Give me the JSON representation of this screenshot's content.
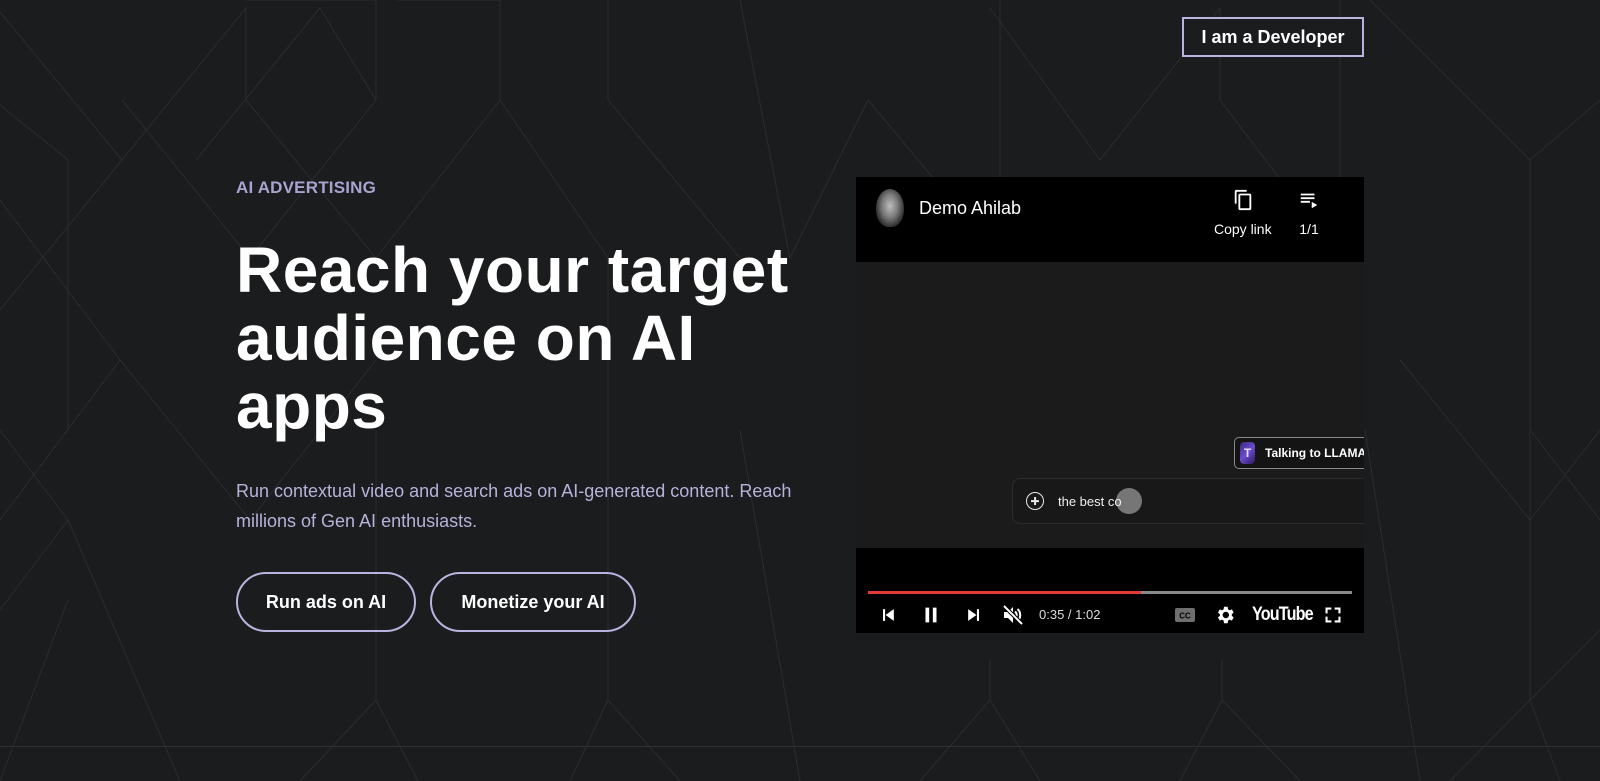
{
  "header": {
    "developer_button": "I am a Developer"
  },
  "hero": {
    "eyebrow": "AI ADVERTISING",
    "headline": "Reach your target audience on AI apps",
    "subtext": "Run contextual video and search ads on AI-generated content. Reach millions of Gen AI enthusiasts.",
    "buttons": [
      {
        "label": "Run ads on AI"
      },
      {
        "label": "Monetize your AI"
      }
    ]
  },
  "video_player": {
    "channel_name": "Demo Ahilab",
    "copy_link_label": "Copy link",
    "playlist_label": "1/1",
    "overlay": {
      "chip_text": "Talking to LLAMA :",
      "chip_icon_letter": "T",
      "chat_input_text": "the best co"
    },
    "time_display": "0:35 / 1:02",
    "progress_fraction": 0.565,
    "brand_label": "YouTube",
    "colors": {
      "progress": "#e53935",
      "track": "#8a8a8a"
    },
    "icons": [
      "avatar",
      "copy-icon",
      "playlist-icon",
      "plus-circle-icon",
      "previous-icon",
      "pause-icon",
      "next-icon",
      "muted-volume-icon",
      "captions-icon",
      "settings-gear-icon",
      "fullscreen-icon"
    ]
  },
  "theme": {
    "background": "#1a1c1e",
    "accent": "#bab3e0",
    "eyebrow_color": "#a9a3d1"
  }
}
